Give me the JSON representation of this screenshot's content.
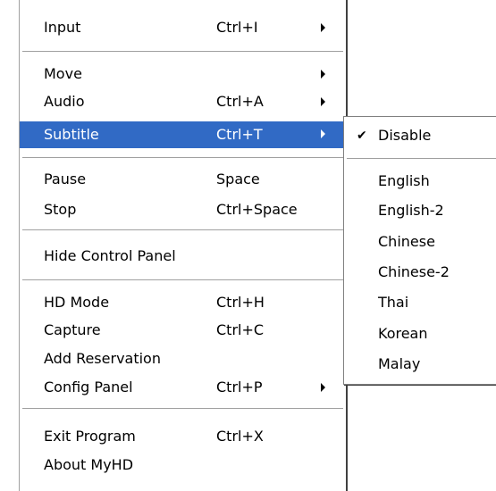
{
  "main_menu": {
    "items": [
      {
        "label": "Input",
        "shortcut": "Ctrl+I"
      },
      {
        "label": "Move",
        "shortcut": ""
      },
      {
        "label": "Audio",
        "shortcut": "Ctrl+A"
      },
      {
        "label": "Subtitle",
        "shortcut": "Ctrl+T"
      },
      {
        "label": "Pause",
        "shortcut": "Space"
      },
      {
        "label": "Stop",
        "shortcut": "Ctrl+Space"
      },
      {
        "label": "Hide Control Panel",
        "shortcut": ""
      },
      {
        "label": "HD Mode",
        "shortcut": "Ctrl+H"
      },
      {
        "label": "Capture",
        "shortcut": "Ctrl+C"
      },
      {
        "label": "Add Reservation",
        "shortcut": ""
      },
      {
        "label": "Config Panel",
        "shortcut": "Ctrl+P"
      },
      {
        "label": "Exit Program",
        "shortcut": "Ctrl+X"
      },
      {
        "label": "About MyHD",
        "shortcut": ""
      }
    ]
  },
  "subtitle_menu": {
    "check_mark": "✔",
    "items": [
      {
        "label": "Disable",
        "checked": true
      },
      {
        "label": "English"
      },
      {
        "label": "English-2"
      },
      {
        "label": "Chinese"
      },
      {
        "label": "Chinese-2"
      },
      {
        "label": "Thai"
      },
      {
        "label": "Korean"
      },
      {
        "label": "Malay"
      }
    ]
  },
  "colors": {
    "highlight": "#316ac5",
    "highlight_text": "#ffffff",
    "separator": "#a0a0a0"
  }
}
